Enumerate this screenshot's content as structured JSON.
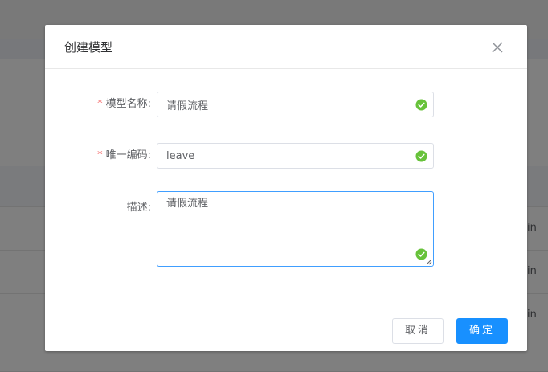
{
  "background": {
    "row_cells": [
      "in",
      "in",
      "in"
    ]
  },
  "dialog": {
    "title": "创建模型",
    "close_icon": "close-icon",
    "fields": {
      "name": {
        "required_mark": "*",
        "label": "模型名称:",
        "value": "请假流程",
        "status_icon": "check-circle-icon"
      },
      "code": {
        "required_mark": "*",
        "label": "唯一编码:",
        "value": "leave",
        "status_icon": "check-circle-icon"
      },
      "description": {
        "label": "描述:",
        "value": "请假流程",
        "status_icon": "check-circle-icon"
      }
    },
    "footer": {
      "cancel_label": "取消",
      "confirm_label": "确定"
    }
  },
  "colors": {
    "primary": "#1890ff",
    "success": "#67c23a",
    "required": "#f56c6c",
    "overlay": "rgba(0,0,0,0.5)"
  }
}
